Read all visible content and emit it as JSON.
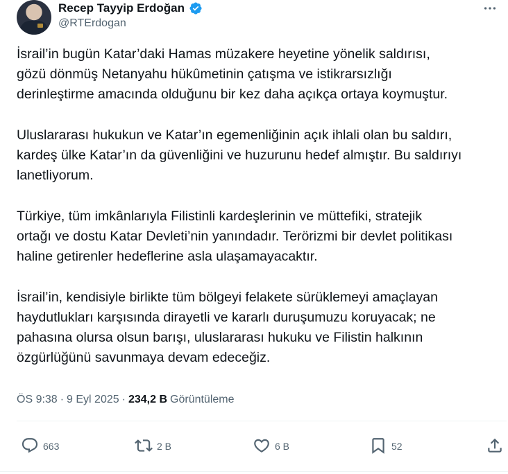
{
  "author": {
    "display_name": "Recep Tayyip Erdoğan",
    "handle": "@RTErdogan",
    "verified": true,
    "verified_color": "#1d9bf0"
  },
  "tweet": {
    "paragraphs": [
      "İsrail’in bugün Katar’daki Hamas müzakere heyetine yönelik saldırısı,\ngözü dönmüş Netanyahu hükûmetinin çatışma ve istikrarsızlığı\nderinleştirme amacında olduğunu bir kez daha açıkça ortaya koymuştur.",
      "Uluslararası hukukun ve Katar’ın egemenliğinin açık ihlali olan bu saldırı,\nkardeş ülke Katar’ın da güvenliğini ve huzurunu hedef almıştır. Bu saldırıyı\nlanetliyorum.",
      "Türkiye, tüm imkânlarıyla Filistinli kardeşlerinin ve müttefiki, stratejik\nortağı ve dostu Katar Devleti’nin yanındadır. Terörizmi bir devlet politikası\nhaline getirenler hedeflerine asla ulaşamayacaktır.",
      "İsrail’in, kendisiyle birlikte tüm bölgeyi felakete sürüklemeyi amaçlayan\nhaydutlukları karşısında dirayetli ve kararlı duruşumuzu koruyacak; ne\npahasına olursa olsun barışı, uluslararası hukuku ve Filistin halkının\nözgürlüğünü savunmaya devam edeceğiz."
    ]
  },
  "meta": {
    "time": "ÖS 9:38",
    "separator": "·",
    "date": "9 Eyl 2025",
    "views_count": "234,2 B",
    "views_label": "Görüntüleme"
  },
  "actions": {
    "replies": "663",
    "reposts": "2 B",
    "likes": "6 B",
    "bookmarks": "52"
  },
  "icons": {
    "verified": "verified-badge-icon",
    "more": "more-horizontal-icon",
    "reply": "reply-icon",
    "repost": "repost-icon",
    "like": "heart-icon",
    "bookmark": "bookmark-icon",
    "share": "share-icon"
  },
  "colors": {
    "text_primary": "#0f1419",
    "text_secondary": "#536471",
    "accent": "#1d9bf0"
  }
}
